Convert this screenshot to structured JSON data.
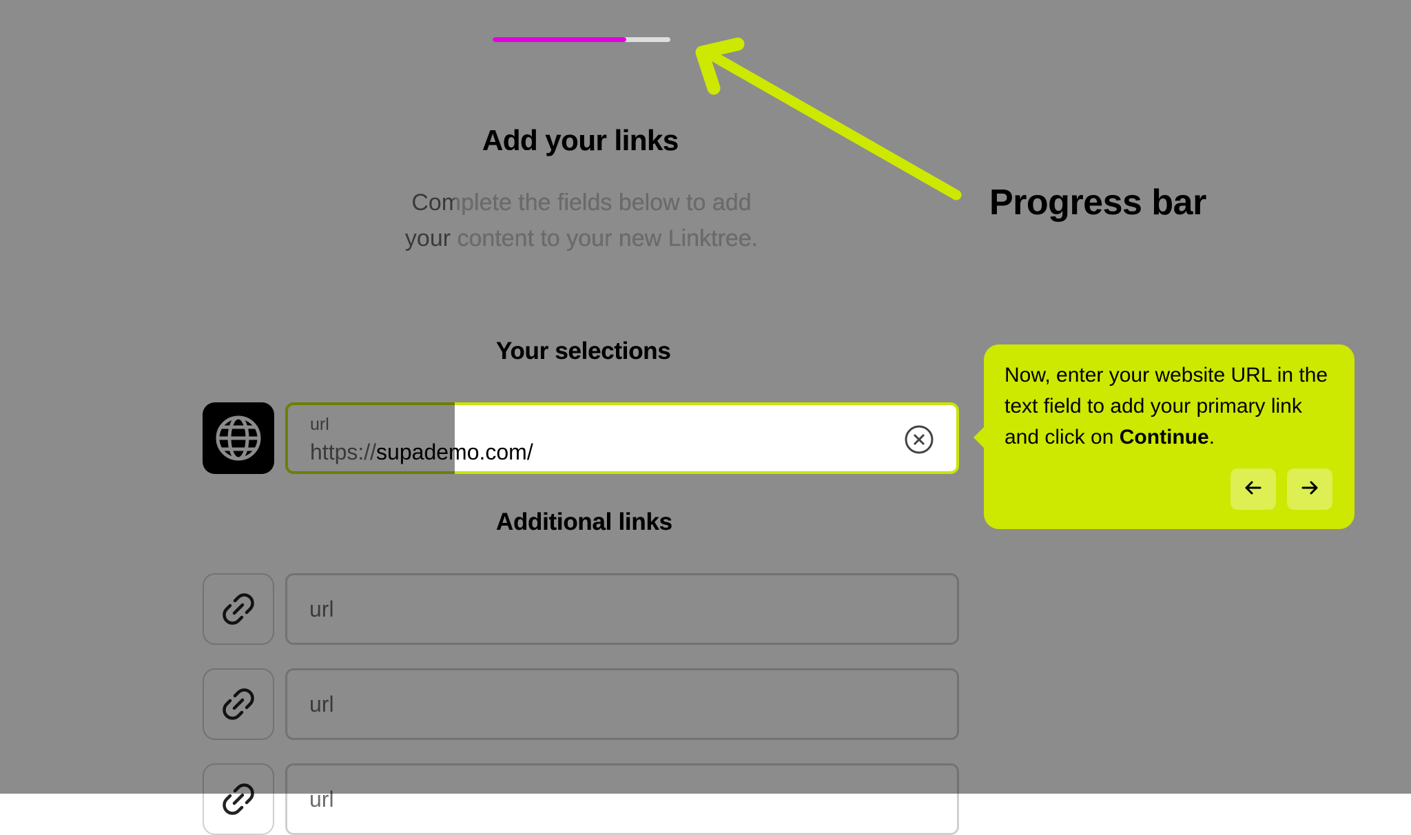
{
  "heading": {
    "title": "Add your links",
    "subtitle_line1": "Complete the fields below to add",
    "subtitle_line2": "your content to your new Linktree."
  },
  "progress": {
    "value": 0.75,
    "fill_color": "#e000e0",
    "track_color": "#dedede"
  },
  "selections": {
    "title": "Your selections",
    "website_field": {
      "label": "url",
      "prefix": "https://",
      "value": "supademo.com/",
      "icon": "globe-icon",
      "clear_icon": "clear-icon"
    }
  },
  "additional": {
    "title": "Additional links",
    "fields": [
      {
        "placeholder": "url",
        "icon": "link-icon"
      },
      {
        "placeholder": "url",
        "icon": "link-icon"
      },
      {
        "placeholder": "url",
        "icon": "link-icon"
      }
    ]
  },
  "annotation": {
    "label": "Progress bar",
    "arrow_color": "#cde801"
  },
  "tooltip": {
    "text_before": "Now, enter your website URL in the text field to add your primary link and click on ",
    "text_bold": "Continue",
    "text_after": ".",
    "back_icon": "arrow-left-icon",
    "next_icon": "arrow-right-icon",
    "background": "#cde801"
  }
}
